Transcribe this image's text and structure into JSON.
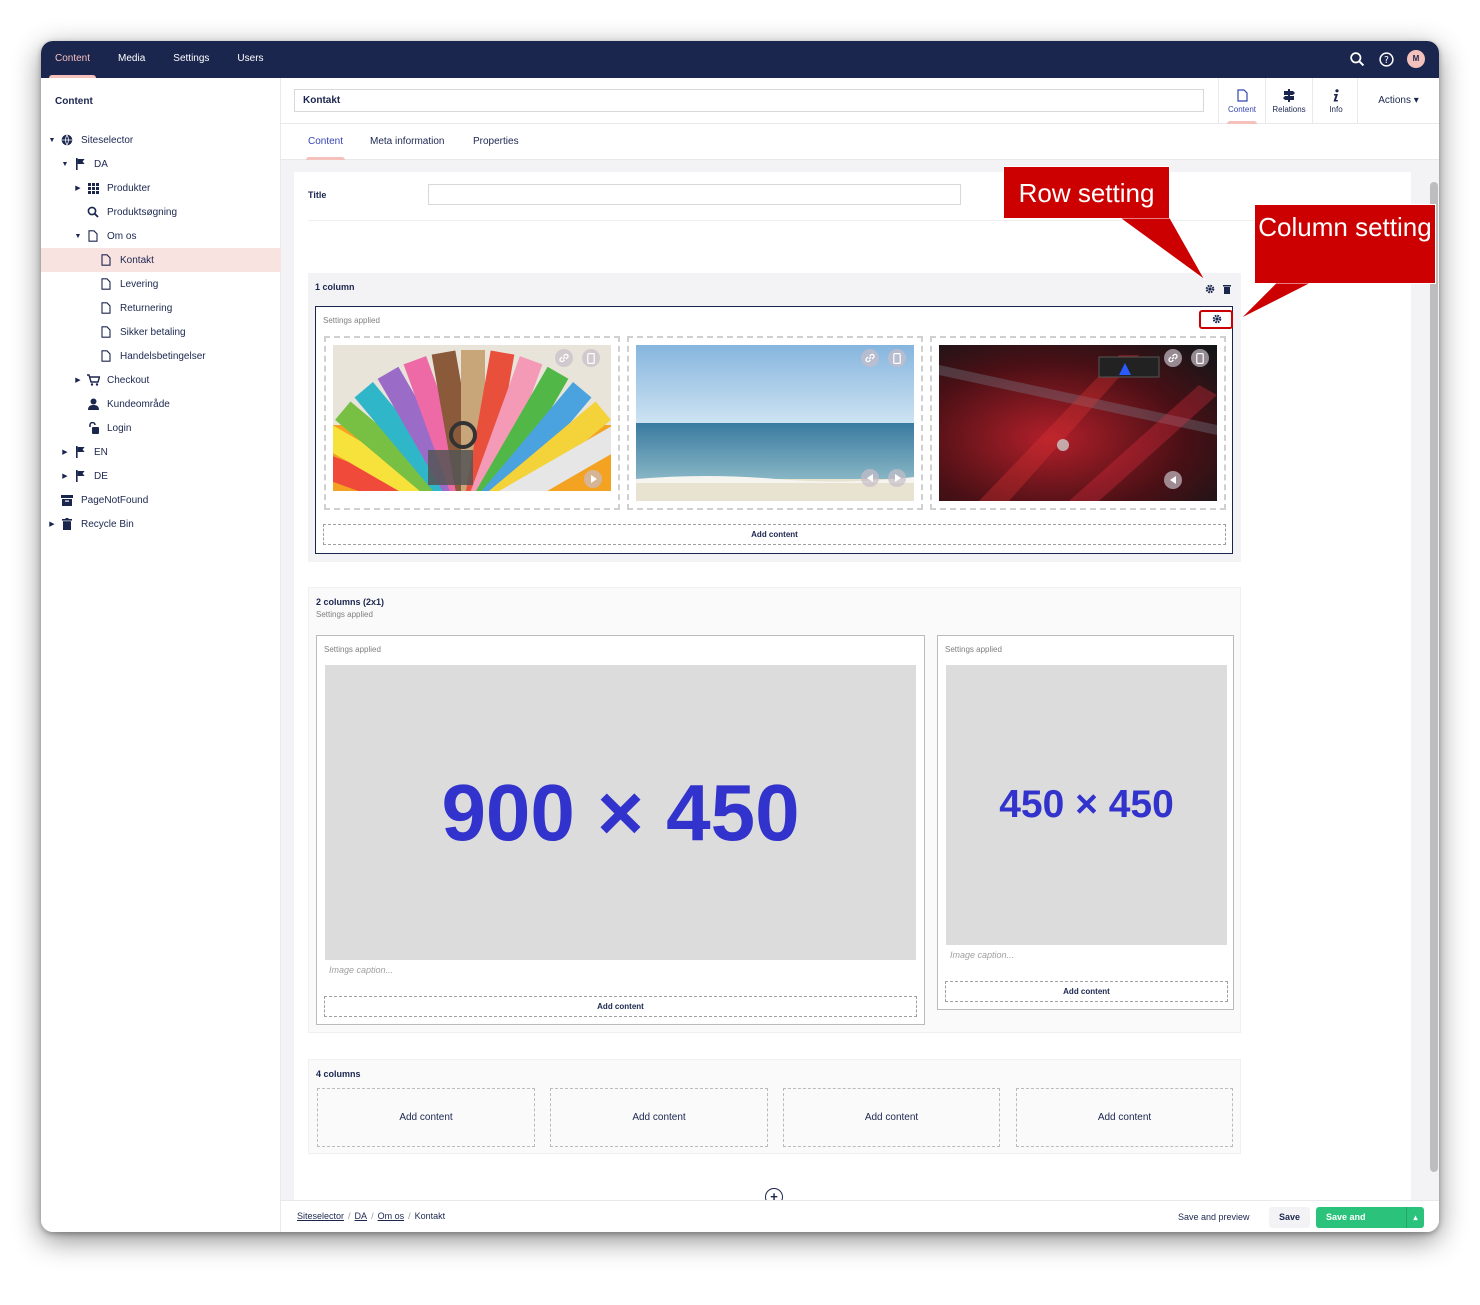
{
  "topnav": {
    "items": [
      "Content",
      "Media",
      "Settings",
      "Users"
    ],
    "active": "Content",
    "avatar_initial": "M"
  },
  "sidebar": {
    "title": "Content",
    "tree": [
      {
        "label": "Siteselector",
        "icon": "globe-icon",
        "level": 0,
        "caret": "down"
      },
      {
        "label": "DA",
        "icon": "flag-icon",
        "level": 1,
        "caret": "down"
      },
      {
        "label": "Produkter",
        "icon": "grid-icon",
        "level": 2,
        "caret": "right"
      },
      {
        "label": "Produktsøgning",
        "icon": "search-icon",
        "level": 2,
        "caret": ""
      },
      {
        "label": "Om os",
        "icon": "document-icon",
        "level": 2,
        "caret": "down"
      },
      {
        "label": "Kontakt",
        "icon": "document-icon",
        "level": 3,
        "caret": "",
        "selected": true
      },
      {
        "label": "Levering",
        "icon": "document-icon",
        "level": 3,
        "caret": ""
      },
      {
        "label": "Returnering",
        "icon": "document-icon",
        "level": 3,
        "caret": ""
      },
      {
        "label": "Sikker betaling",
        "icon": "document-icon",
        "level": 3,
        "caret": ""
      },
      {
        "label": "Handelsbetingelser",
        "icon": "document-icon",
        "level": 3,
        "caret": ""
      },
      {
        "label": "Checkout",
        "icon": "cart-icon",
        "level": 2,
        "caret": "right"
      },
      {
        "label": "Kundeområde",
        "icon": "user-icon",
        "level": 2,
        "caret": ""
      },
      {
        "label": "Login",
        "icon": "unlock-icon",
        "level": 2,
        "caret": ""
      },
      {
        "label": "EN",
        "icon": "flag-icon",
        "level": 1,
        "caret": "right"
      },
      {
        "label": "DE",
        "icon": "flag-icon",
        "level": 1,
        "caret": "right"
      },
      {
        "label": "PageNotFound",
        "icon": "archive-icon",
        "level": 0,
        "caret": ""
      },
      {
        "label": "Recycle Bin",
        "icon": "trash-icon",
        "level": 0,
        "caret": "right"
      }
    ]
  },
  "header": {
    "node_name": "Kontakt",
    "apps": [
      {
        "label": "Content",
        "icon": "document-icon",
        "active": true
      },
      {
        "label": "Relations",
        "icon": "signpost-icon",
        "active": false
      },
      {
        "label": "Info",
        "icon": "info-icon",
        "active": false
      }
    ],
    "actions_label": "Actions ▾"
  },
  "tabs": [
    "Content",
    "Meta information",
    "Properties"
  ],
  "title_property": {
    "label": "Title",
    "value": ""
  },
  "grid": {
    "row1": {
      "title": "1 column",
      "settings": "Settings applied",
      "add_content": "Add content"
    },
    "row2": {
      "title": "2 columns (2x1)",
      "settings": "Settings applied",
      "col1": {
        "settings": "Settings applied",
        "placeholder": "900 × 450",
        "caption": "Image caption...",
        "add_content": "Add content"
      },
      "col2": {
        "settings": "Settings applied",
        "placeholder": "450 × 450",
        "caption": "Image caption...",
        "add_content": "Add content"
      }
    },
    "row3": {
      "title": "4 columns",
      "cells": [
        "Add content",
        "Add content",
        "Add content",
        "Add content"
      ]
    }
  },
  "callouts": {
    "row": "Row setting",
    "column": "Column setting"
  },
  "footer": {
    "breadcrumbs": [
      "Siteselector",
      "DA",
      "Om os"
    ],
    "current": "Kontakt",
    "save_preview": "Save and preview",
    "save": "Save",
    "save_publish": "Save and publish"
  },
  "colors": {
    "topbar": "#1b264f",
    "accent_pink": "#f5c1bc",
    "publish_green": "#2bc37c",
    "callout_red": "#cc0000",
    "placeholder_text": "#3232cc"
  }
}
